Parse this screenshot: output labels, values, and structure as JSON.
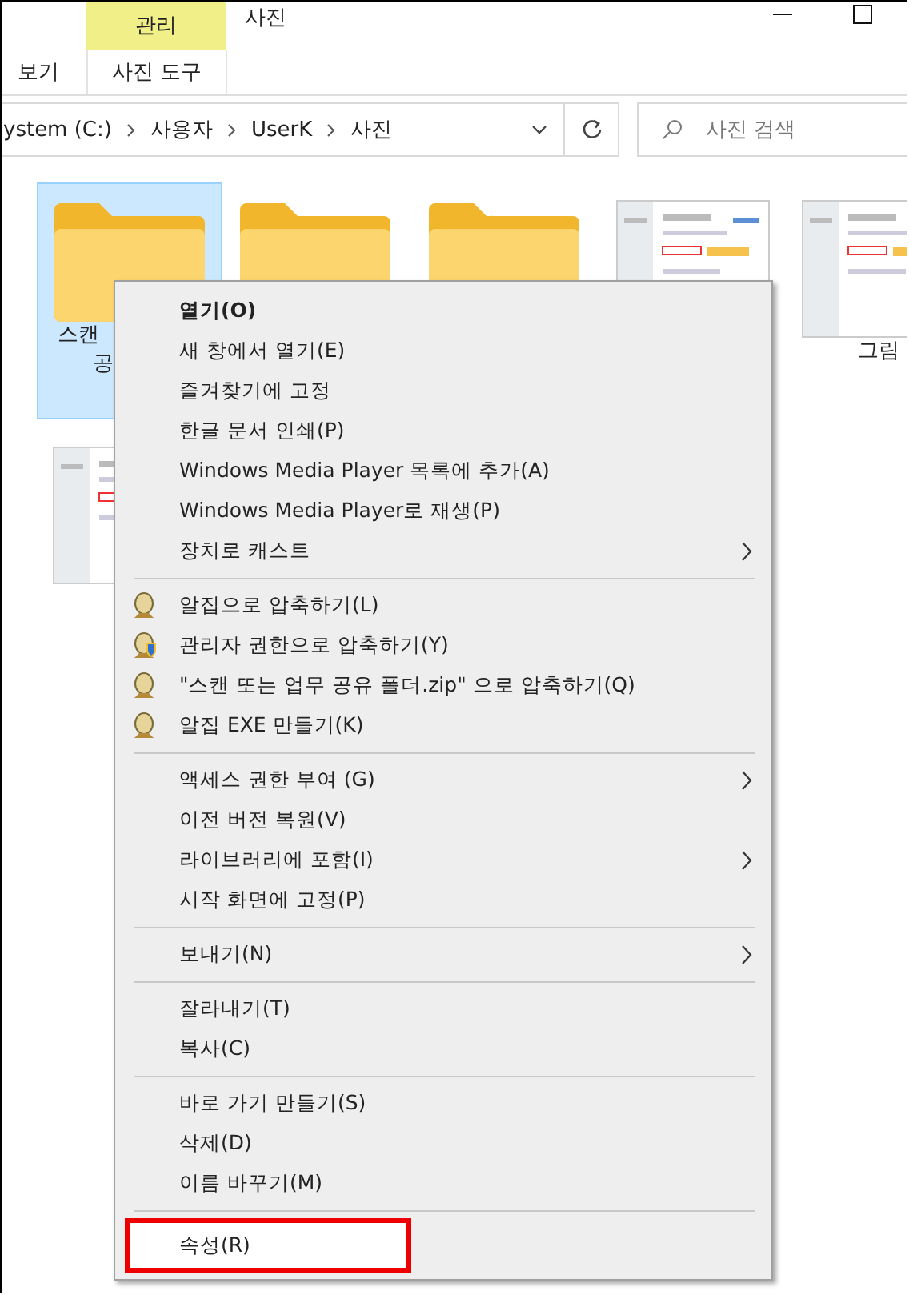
{
  "ribbon": {
    "context_tab": "관리",
    "title": "사진",
    "tabs": [
      {
        "label": "보기",
        "selected": false
      },
      {
        "label": "사진 도구",
        "selected": true
      }
    ]
  },
  "address": {
    "path": [
      "ystem (C:)",
      "사용자",
      "UserK",
      "사진"
    ]
  },
  "search": {
    "placeholder": "사진 검색"
  },
  "files": [
    {
      "kind": "folder",
      "selected": true,
      "label": [
        "스캔",
        "공"
      ]
    },
    {
      "kind": "folder",
      "selected": false
    },
    {
      "kind": "folder",
      "selected": false
    },
    {
      "kind": "picture",
      "selected": false
    },
    {
      "kind": "picture",
      "selected": false,
      "label": [
        "그림"
      ]
    },
    {
      "kind": "picture",
      "selected": false
    }
  ],
  "context_menu": {
    "groups": [
      [
        {
          "label": "열기(O)",
          "default": true,
          "submenu": false,
          "selected": false,
          "outlined": false
        },
        {
          "label": "새 창에서 열기(E)",
          "default": false,
          "submenu": false,
          "selected": false,
          "outlined": false
        },
        {
          "label": "즐겨찾기에 고정",
          "default": false,
          "submenu": false,
          "selected": false,
          "outlined": false
        },
        {
          "label": "한글 문서 인쇄(P)",
          "default": false,
          "submenu": false,
          "selected": false,
          "outlined": false
        },
        {
          "label": "Windows Media Player 목록에 추가(A)",
          "default": false,
          "submenu": false,
          "selected": false,
          "outlined": false
        },
        {
          "label": "Windows Media Player로 재생(P)",
          "default": false,
          "submenu": false,
          "selected": false,
          "outlined": false
        },
        {
          "label": "장치로 캐스트",
          "default": false,
          "submenu": true,
          "selected": false,
          "outlined": false
        }
      ],
      [
        {
          "label": "알집으로 압축하기(L)",
          "kind": "archive",
          "default": false,
          "submenu": false,
          "selected": false,
          "outlined": false
        },
        {
          "label": "관리자 권한으로 압축하기(Y)",
          "kind": "archive-admin",
          "default": false,
          "submenu": false,
          "selected": false,
          "outlined": false
        },
        {
          "label": "\"스캔 또는 업무 공유 폴더.zip\" 으로 압축하기(Q)",
          "kind": "archive",
          "default": false,
          "submenu": false,
          "selected": false,
          "outlined": false
        },
        {
          "label": "알집 EXE 만들기(K)",
          "kind": "archive",
          "default": false,
          "submenu": false,
          "selected": false,
          "outlined": false
        }
      ],
      [
        {
          "label": "액세스 권한 부여 (G)",
          "default": false,
          "submenu": true,
          "selected": false,
          "outlined": false
        },
        {
          "label": "이전 버전 복원(V)",
          "default": false,
          "submenu": false,
          "selected": false,
          "outlined": false
        },
        {
          "label": "라이브러리에 포함(I)",
          "default": false,
          "submenu": true,
          "selected": false,
          "outlined": false
        },
        {
          "label": "시작 화면에 고정(P)",
          "default": false,
          "submenu": false,
          "selected": false,
          "outlined": false
        }
      ],
      [
        {
          "label": "보내기(N)",
          "default": false,
          "submenu": true,
          "selected": false,
          "outlined": false
        }
      ],
      [
        {
          "label": "잘라내기(T)",
          "default": false,
          "submenu": false,
          "selected": false,
          "outlined": false
        },
        {
          "label": "복사(C)",
          "default": false,
          "submenu": false,
          "selected": false,
          "outlined": false
        }
      ],
      [
        {
          "label": "바로 가기 만들기(S)",
          "default": false,
          "submenu": false,
          "selected": false,
          "outlined": false
        },
        {
          "label": "삭제(D)",
          "default": false,
          "submenu": false,
          "selected": false,
          "outlined": false
        },
        {
          "label": "이름 바꾸기(M)",
          "default": false,
          "submenu": false,
          "selected": false,
          "outlined": false
        }
      ],
      [
        {
          "label": "속성(R)",
          "default": false,
          "submenu": false,
          "selected": true,
          "outlined": true
        }
      ]
    ]
  }
}
